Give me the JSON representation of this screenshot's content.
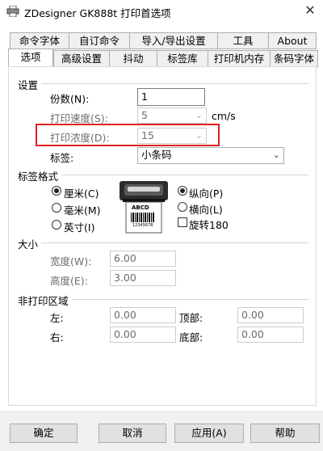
{
  "window": {
    "title": "ZDesigner GK888t 打印首选项",
    "close_glyph": "✕"
  },
  "tabs_top": [
    "命令字体",
    "自订命令",
    "导入/导出设置",
    "工具",
    "About"
  ],
  "tabs_bottom": [
    "选项",
    "高级设置",
    "抖动",
    "标签库",
    "打印机内存",
    "条码字体"
  ],
  "active_tab": "选项",
  "settings": {
    "section_title": "设置",
    "copies_label": "份数(N):",
    "copies_value": "1",
    "speed_label": "打印速度(S):",
    "speed_value": "5",
    "speed_unit": "cm/s",
    "darkness_label": "打印浓度(D):",
    "darkness_value": "15",
    "stock_label": "标签:",
    "stock_value": "小条码"
  },
  "label_format": {
    "section_title": "标签格式",
    "unit_options": [
      "厘米(C)",
      "毫米(M)",
      "英寸(I)"
    ],
    "unit_selected": "厘米(C)",
    "orientation_options": [
      "纵向(P)",
      "横向(L)"
    ],
    "orientation_selected": "纵向(P)",
    "rotate_label": "旋转180",
    "rotate_checked": false,
    "preview_text": "ABCD",
    "preview_barcode_number": "12345678"
  },
  "size": {
    "section_title": "大小",
    "width_label": "宽度(W):",
    "width_value": "6.00",
    "height_label": "高度(E):",
    "height_value": "3.00"
  },
  "unprintable": {
    "section_title": "非打印区域",
    "left_label": "左:",
    "left_value": "0.00",
    "top_label": "顶部:",
    "top_value": "0.00",
    "right_label": "右:",
    "right_value": "0.00",
    "bottom_label": "底部:",
    "bottom_value": "0.00"
  },
  "buttons": {
    "ok": "确定",
    "cancel": "取消",
    "apply": "应用(A)",
    "help": "帮助"
  },
  "colors": {
    "highlight": "#e02020",
    "tab_bg": "#f0f0f0"
  }
}
